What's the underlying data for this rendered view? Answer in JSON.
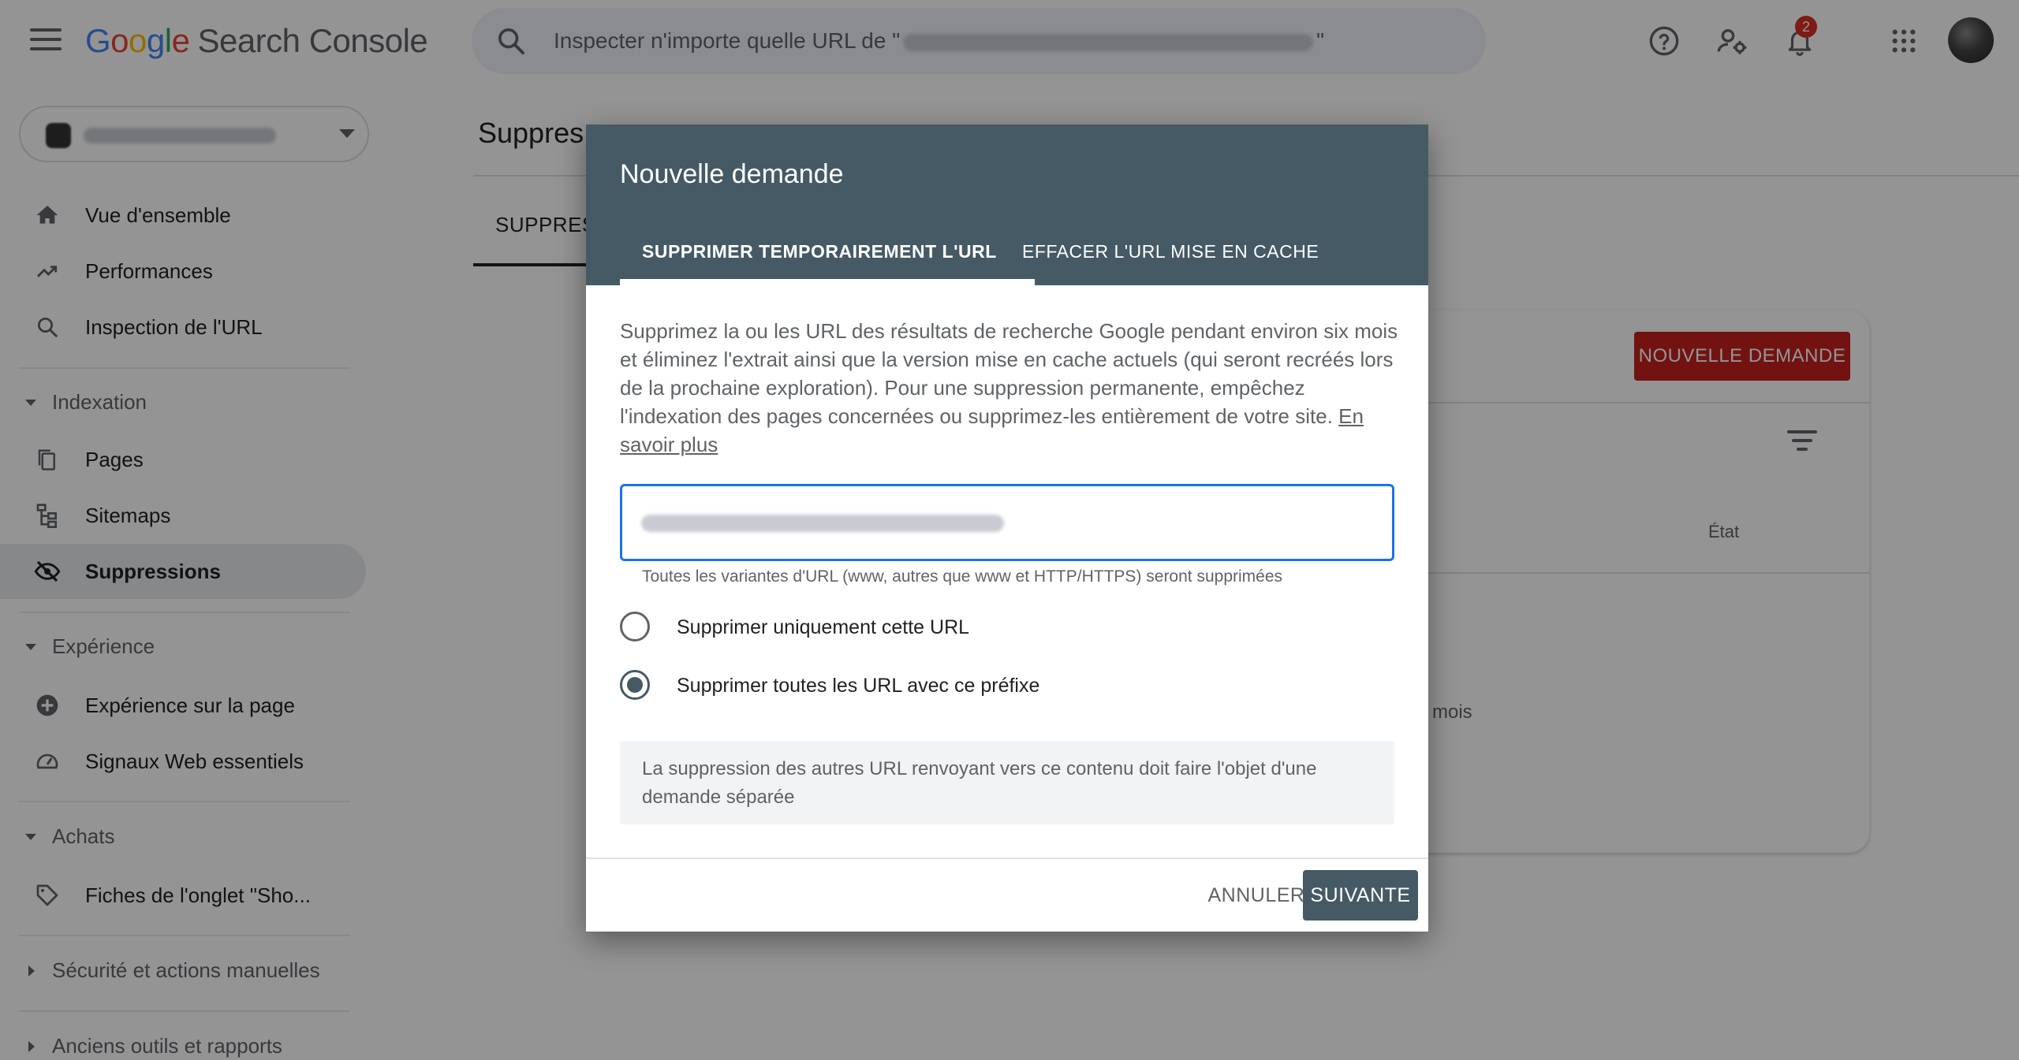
{
  "app": {
    "logo_letters": [
      "G",
      "o",
      "o",
      "g",
      "l",
      "e"
    ],
    "product": "Search Console",
    "search_prefix": "Inspecter n'importe quelle URL de \"",
    "search_suffix": "\"",
    "notifications_count": "2",
    "icons": [
      "menu-icon",
      "search-icon",
      "help-icon",
      "manage-users-icon",
      "bell-icon",
      "apps-grid-icon"
    ]
  },
  "sidebar": {
    "items": [
      {
        "label": "Vue d'ensemble",
        "icon": "home-icon"
      },
      {
        "label": "Performances",
        "icon": "trending-up-icon"
      },
      {
        "label": "Inspection de l'URL",
        "icon": "search-icon"
      }
    ],
    "indexation": {
      "title": "Indexation",
      "items": [
        {
          "label": "Pages",
          "icon": "pages-icon"
        },
        {
          "label": "Sitemaps",
          "icon": "sitemap-icon"
        },
        {
          "label": "Suppressions",
          "icon": "eye-off-icon",
          "active": true
        }
      ]
    },
    "experience": {
      "title": "Expérience",
      "items": [
        {
          "label": "Expérience sur la page",
          "icon": "plus-circle-icon"
        },
        {
          "label": "Signaux Web essentiels",
          "icon": "gauge-icon"
        }
      ]
    },
    "achats": {
      "title": "Achats",
      "items": [
        {
          "label": "Fiches de l'onglet \"Sho...",
          "icon": "tag-icon"
        }
      ]
    },
    "security": "Sécurité et actions manuelles",
    "legacy": "Anciens outils et rapports"
  },
  "main": {
    "title": "Suppres",
    "tab": "SUPPRES",
    "new_request": "NOUVELLE DEMANDE",
    "col_status": "État",
    "months_text": "mois"
  },
  "dialog": {
    "title": "Nouvelle demande",
    "tabs": [
      "SUPPRIMER TEMPORAIREMENT L'URL",
      "EFFACER L'URL MISE EN CACHE"
    ],
    "active_tab": 0,
    "description": "Supprimez la ou les URL des résultats de recherche Google pendant environ six mois et éliminez l'extrait ainsi que la version mise en cache actuels (qui seront recréés lors de la prochaine exploration). Pour une suppression permanente, empêchez l'indexation des pages concernées ou supprimez-les entièrement de votre site.",
    "learn_more": "En savoir plus",
    "helper": "Toutes les variantes d'URL (www, autres que www et HTTP/HTTPS) seront supprimées",
    "options": [
      {
        "label": "Supprimer uniquement cette URL",
        "checked": false
      },
      {
        "label": "Supprimer toutes les URL avec ce préfixe",
        "checked": true
      }
    ],
    "info": "La suppression des autres URL renvoyant vers ce contenu doit faire l'objet d'une demande séparée",
    "cancel": "ANNULER",
    "next": "SUIVANTE"
  },
  "colors": {
    "dialog_header": "#455a64",
    "primary_red": "#c5221f",
    "input_focus": "#1a73e8",
    "badge": "#d93025"
  }
}
